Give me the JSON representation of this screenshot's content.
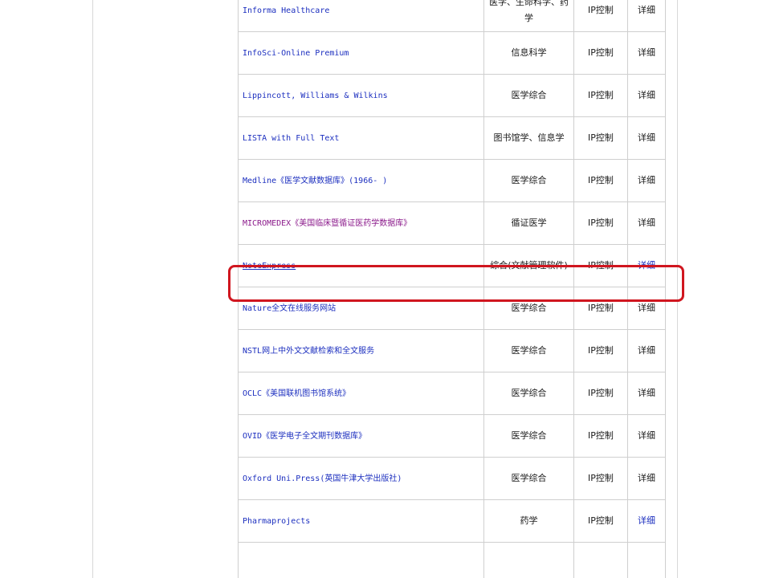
{
  "table": {
    "rows": [
      {
        "name": "Informa Healthcare",
        "subject": "医学、生命科学、药学",
        "access": "IP控制",
        "detail": "详细",
        "visited": false,
        "underlined": false,
        "detail_blue": false
      },
      {
        "name": "InfoSci-Online Premium",
        "subject": "信息科学",
        "access": "IP控制",
        "detail": "详细",
        "visited": false,
        "underlined": false,
        "detail_blue": false
      },
      {
        "name": "Lippincott, Williams & Wilkins",
        "subject": "医学综合",
        "access": "IP控制",
        "detail": "详细",
        "visited": false,
        "underlined": false,
        "detail_blue": false
      },
      {
        "name": "LISTA with Full Text",
        "subject": "图书馆学、信息学",
        "access": "IP控制",
        "detail": "详细",
        "visited": false,
        "underlined": false,
        "detail_blue": false
      },
      {
        "name": "Medline《医学文献数据库》(1966- )",
        "subject": "医学综合",
        "access": "IP控制",
        "detail": "详细",
        "visited": false,
        "underlined": false,
        "detail_blue": false
      },
      {
        "name": "MICROMEDEX《美国临床暨循证医药学数据库》",
        "subject": "循证医学",
        "access": "IP控制",
        "detail": "详细",
        "visited": true,
        "underlined": false,
        "detail_blue": false
      },
      {
        "name": "NoteExpress",
        "subject": "综合(文献管理软件)",
        "access": "IP控制",
        "detail": "详细",
        "visited": false,
        "underlined": true,
        "detail_blue": true
      },
      {
        "name": "Nature全文在线服务网站",
        "subject": "医学综合",
        "access": "IP控制",
        "detail": "详细",
        "visited": false,
        "underlined": false,
        "detail_blue": false
      },
      {
        "name": "NSTL网上中外文文献检索和全文服务",
        "subject": "医学综合",
        "access": "IP控制",
        "detail": "详细",
        "visited": false,
        "underlined": false,
        "detail_blue": false
      },
      {
        "name": "OCLC《美国联机图书馆系统》",
        "subject": "医学综合",
        "access": "IP控制",
        "detail": "详细",
        "visited": false,
        "underlined": false,
        "detail_blue": false
      },
      {
        "name": "OVID《医学电子全文期刊数据库》",
        "subject": "医学综合",
        "access": "IP控制",
        "detail": "详细",
        "visited": false,
        "underlined": false,
        "detail_blue": false
      },
      {
        "name": "Oxford Uni.Press(英国牛津大学出版社)",
        "subject": "医学综合",
        "access": "IP控制",
        "detail": "详细",
        "visited": false,
        "underlined": false,
        "detail_blue": false
      },
      {
        "name": "Pharmaprojects",
        "subject": "药学",
        "access": "IP控制",
        "detail": "详细",
        "visited": false,
        "underlined": false,
        "detail_blue": true
      },
      {
        "name": "",
        "subject": "",
        "access": "",
        "detail": "",
        "visited": false,
        "underlined": false,
        "detail_blue": false
      }
    ]
  },
  "colors": {
    "link": "#1c2fbf",
    "visited_link": "#8b1a8b",
    "highlight": "#d0161f",
    "border": "#cfcfcf"
  }
}
